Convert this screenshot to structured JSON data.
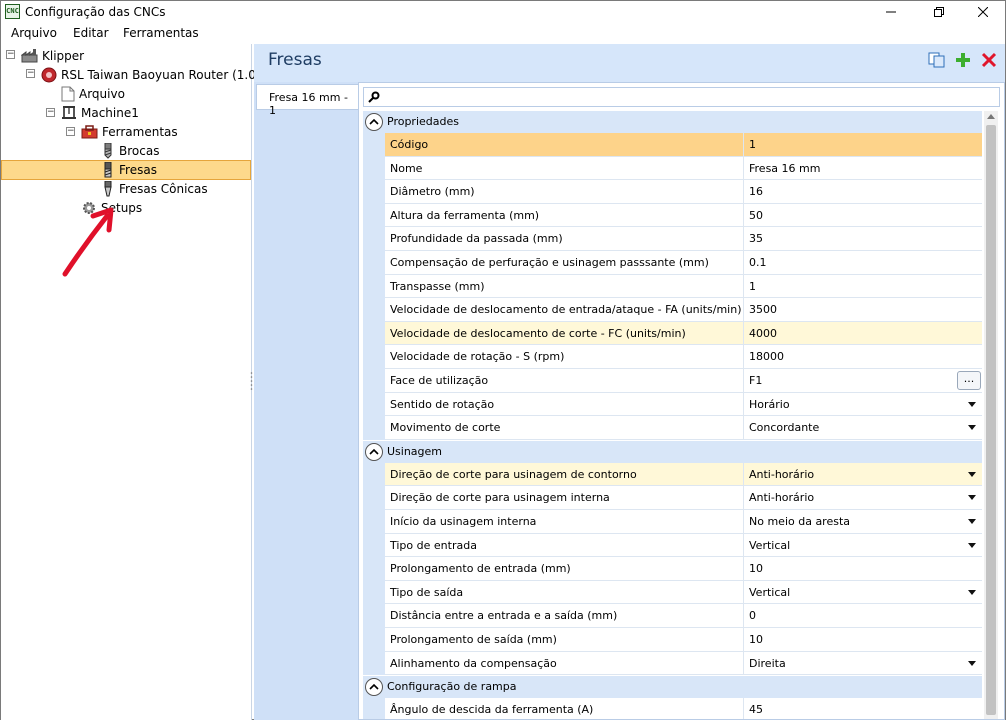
{
  "window": {
    "title": "Configuração das CNCs",
    "app_icon_text": "CNC"
  },
  "menu": [
    "Arquivo",
    "Editar",
    "Ferramentas"
  ],
  "tree": {
    "root": "Klipper",
    "router": "RSL Taiwan Baoyuan Router (1.0)",
    "arquivo": "Arquivo",
    "machine": "Machine1",
    "ferramentas": "Ferramentas",
    "brocas": "Brocas",
    "fresas": "Fresas",
    "fresas_conicas": "Fresas Cônicas",
    "setups": "Setups"
  },
  "panel": {
    "title": "Fresas",
    "tab": "Fresa 16 mm - 1",
    "search_placeholder": ""
  },
  "grid": {
    "categories": {
      "propriedades": "Propriedades",
      "usinagem": "Usinagem",
      "rampa": "Configuração de rampa"
    },
    "propriedades": [
      {
        "name": "Código",
        "value": "1"
      },
      {
        "name": "Nome",
        "value": "Fresa 16 mm"
      },
      {
        "name": "Diâmetro (mm)",
        "value": "16"
      },
      {
        "name": "Altura da ferramenta (mm)",
        "value": "50"
      },
      {
        "name": "Profundidade da passada (mm)",
        "value": "35"
      },
      {
        "name": "Compensação de perfuração e usinagem passsante (mm)",
        "value": "0.1"
      },
      {
        "name": "Transpasse (mm)",
        "value": "1"
      },
      {
        "name": "Velocidade de deslocamento de entrada/ataque - FA (units/min)",
        "value": "3500"
      },
      {
        "name": "Velocidade de deslocamento de corte - FC (units/min)",
        "value": "4000"
      },
      {
        "name": "Velocidade de rotação - S (rpm)",
        "value": "18000"
      },
      {
        "name": "Face de utilização",
        "value": "F1",
        "ellipsis": "..."
      },
      {
        "name": "Sentido de rotação",
        "value": "Horário"
      },
      {
        "name": "Movimento de corte",
        "value": "Concordante"
      }
    ],
    "usinagem": [
      {
        "name": "Direção de corte para usinagem de contorno",
        "value": "Anti-horário"
      },
      {
        "name": "Direção de corte para usinagem interna",
        "value": "Anti-horário"
      },
      {
        "name": "Início da usinagem interna",
        "value": "No meio da aresta"
      },
      {
        "name": "Tipo de entrada",
        "value": "Vertical"
      },
      {
        "name": "Prolongamento de entrada (mm)",
        "value": "10"
      },
      {
        "name": "Tipo de saída",
        "value": "Vertical"
      },
      {
        "name": "Distância entre a entrada e a saída (mm)",
        "value": "0"
      },
      {
        "name": "Prolongamento de saída (mm)",
        "value": "10"
      },
      {
        "name": "Alinhamento da compensação",
        "value": "Direita"
      }
    ],
    "rampa": [
      {
        "name": "Ângulo de descida da ferramenta (A)",
        "value": "45"
      }
    ]
  },
  "colors": {
    "selection": "#fdd98b",
    "highlight": "#fff8d8",
    "panel_bg": "#d6e6fa",
    "annotation": "#e0102a"
  }
}
